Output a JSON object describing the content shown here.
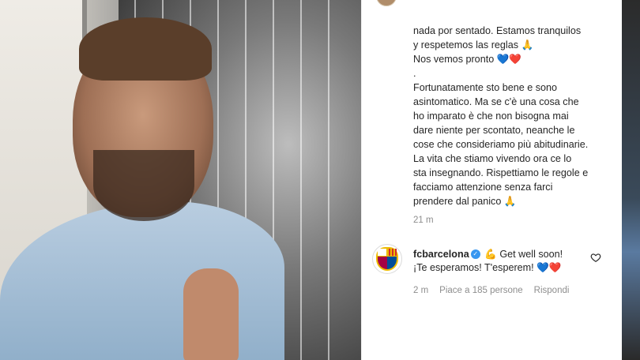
{
  "caption": {
    "lines": [
      "nada por sentado. Estamos tranquilos",
      "y respetemos las reglas 🙏",
      "Nos vemos pronto 💙❤️",
      ".",
      "Fortunatamente sto bene e sono",
      "asintomatico. Ma se c'è una cosa che",
      "ho imparato è che non bisogna mai",
      "dare niente per scontato, neanche le",
      "cose che consideriamo più abitudinarie.",
      "La vita che stiamo vivendo ora ce lo",
      "sta insegnando. Rispettiamo le regole e",
      "facciamo attenzione senza farci",
      "prendere dal panico 🙏"
    ],
    "time": "21 m"
  },
  "comment": {
    "username": "fcbarcelona",
    "verified_symbol": "✓",
    "text_line1": "💪 Get well soon!",
    "text_line2": "¡Te esperamos! T'esperem! 💙❤️",
    "time": "2 m",
    "likes": "Piace a 185 persone",
    "reply": "Rispondi"
  },
  "icons": {
    "like": "heart-outline-icon",
    "avatar": "fc-barcelona-crest-icon"
  },
  "colors": {
    "text": "#262626",
    "muted": "#8e8e8e",
    "verified": "#3897f0",
    "heart_blue": "#2d7be0",
    "heart_red": "#e0282e"
  }
}
